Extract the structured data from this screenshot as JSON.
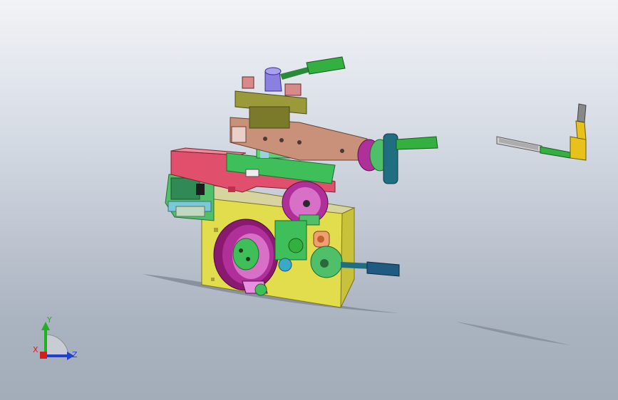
{
  "viewport": {
    "background_top": "#f2f3f6",
    "background_bottom": "#a3acb9"
  },
  "model": {
    "colors": {
      "base_yellow": "#e2dd4c",
      "saddle_red": "#e0506c",
      "slide_green": "#3fbf5a",
      "cross_slide_tan": "#c9907a",
      "tool_post": "#9a9a3a",
      "handwheel_magenta": "#b0309a",
      "handle_green": "#33b040",
      "handle_teal": "#1f6f80",
      "lever_yellow": "#e8c21a",
      "knob_blue": "#8a80e0"
    }
  },
  "triad": {
    "x_label": "X",
    "y_label": "Y",
    "z_label": "Z",
    "x_color": "#d02020",
    "y_color": "#20b020",
    "z_color": "#2040d0"
  }
}
